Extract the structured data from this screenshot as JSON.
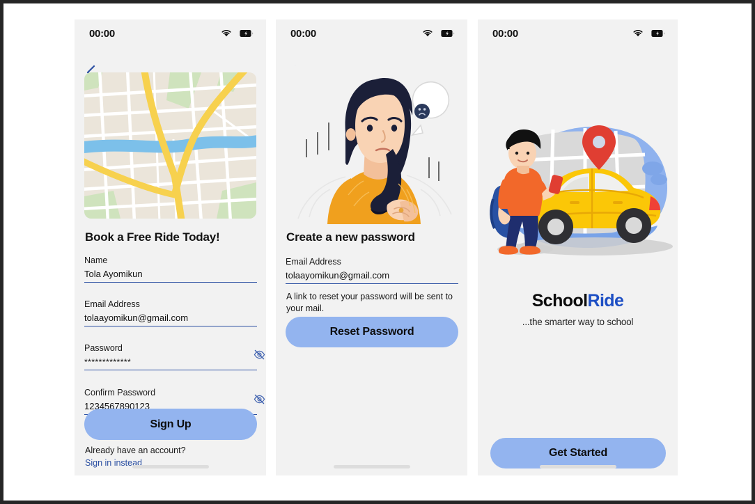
{
  "app": {
    "brand_primary": "#93b4ef",
    "brand_link": "#2b4fa2",
    "panel_bg": "#f2f2f2"
  },
  "screens": [
    {
      "id": "sign-up",
      "status": {
        "time": "00:00",
        "wifi_icon": "wifi-icon",
        "battery_icon": "battery-charging-icon"
      },
      "back_icon": "chevron-left-icon",
      "hero_icon": "map-illustration",
      "title": "Book a Free Ride Today!",
      "fields": [
        {
          "label": "Name",
          "value": "Tola Ayomikun",
          "masked": false,
          "toggle_icon": null
        },
        {
          "label": "Email Address",
          "value": "tolaayomikun@gmail.com",
          "masked": false,
          "toggle_icon": null
        },
        {
          "label": "Password",
          "value": "*************",
          "masked": true,
          "toggle_icon": "eye-off-icon"
        },
        {
          "label": "Confirm Password",
          "value": "1234567890123",
          "masked": false,
          "toggle_icon": "eye-off-icon"
        }
      ],
      "submit_label": "Sign Up",
      "foot_text": "Already have an account?",
      "foot_link": "Sign in instead"
    },
    {
      "id": "create-new-password",
      "status": {
        "time": "00:00",
        "wifi_icon": "wifi-icon",
        "battery_icon": "battery-charging-icon"
      },
      "back_icon": "chevron-left-icon",
      "hero_icon": "worried-woman-illustration",
      "title": "Create a new password",
      "fields": [
        {
          "label": "Email Address",
          "value": "tolaayomikun@gmail.com",
          "masked": false,
          "toggle_icon": null
        }
      ],
      "helper": "A link to reset your password will be sent to your mail.",
      "submit_label": "Reset Password"
    },
    {
      "id": "onboarding",
      "status": {
        "time": "00:00",
        "wifi_icon": "wifi-icon",
        "battery_icon": "battery-charging-icon"
      },
      "hero_icon": "student-car-map-illustration",
      "brand_part_one": "School",
      "brand_part_two": "Ride",
      "tagline": "...the smarter way to school",
      "submit_label": "Get Started"
    }
  ]
}
